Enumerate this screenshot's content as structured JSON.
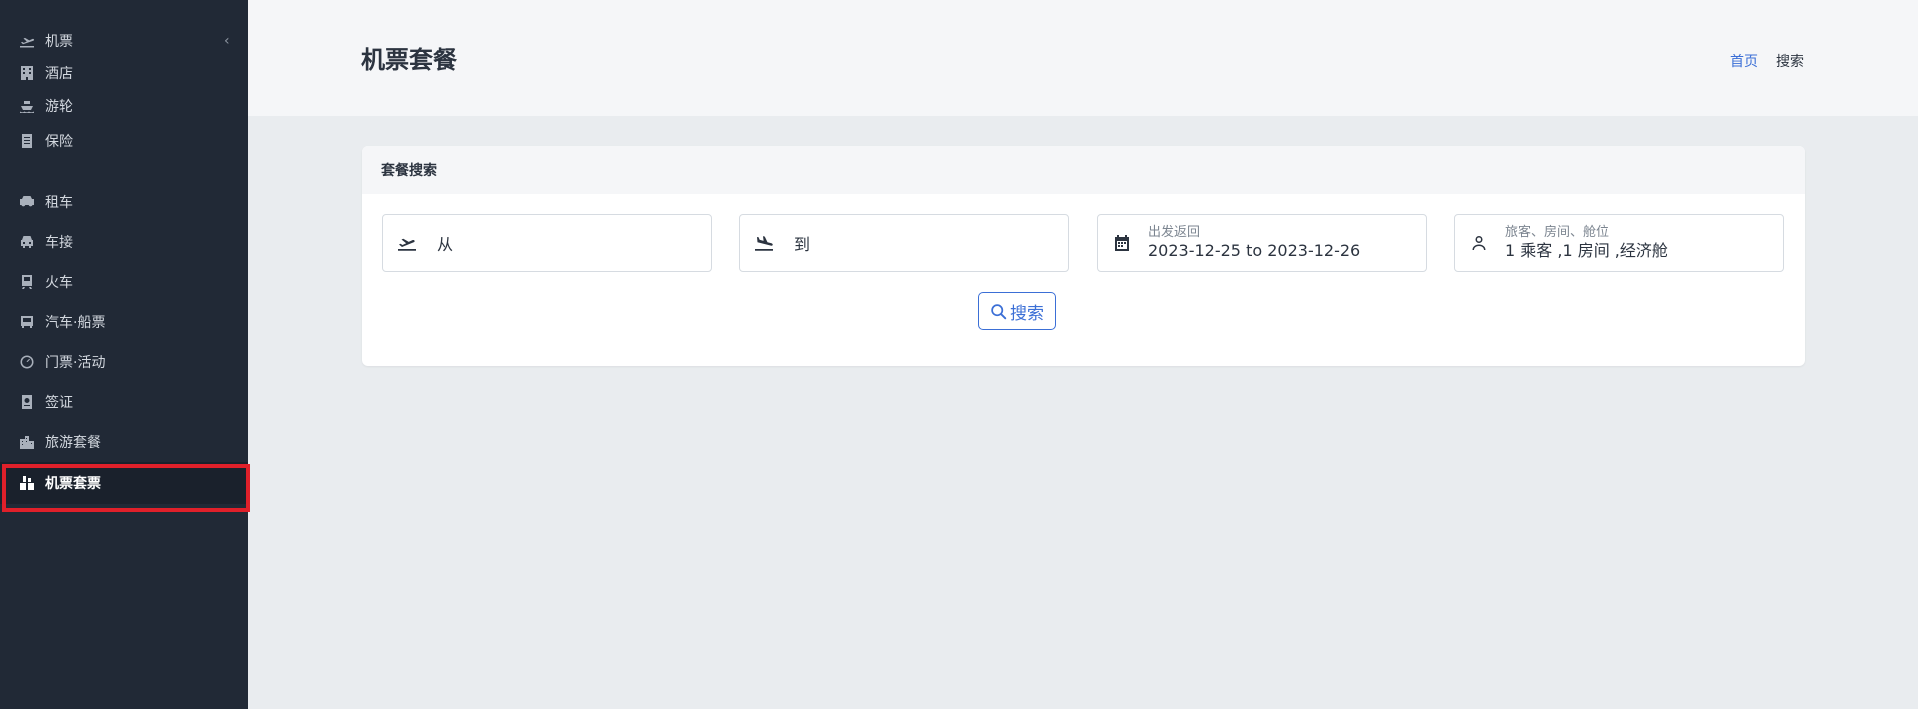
{
  "sidebar": {
    "items": [
      {
        "label": "机票",
        "icon": "plane-takeoff-icon"
      },
      {
        "label": "酒店",
        "icon": "hotel-icon"
      },
      {
        "label": "游轮",
        "icon": "ship-icon"
      },
      {
        "label": "保险",
        "icon": "document-icon"
      },
      {
        "label": "租车",
        "icon": "car-rental-icon"
      },
      {
        "label": "车接",
        "icon": "car-icon"
      },
      {
        "label": "火车",
        "icon": "train-icon"
      },
      {
        "label": "汽车·船票",
        "icon": "bus-icon"
      },
      {
        "label": "门票·活动",
        "icon": "ticket-icon"
      },
      {
        "label": "签证",
        "icon": "passport-icon"
      },
      {
        "label": "旅游套餐",
        "icon": "city-icon"
      },
      {
        "label": "机票套票",
        "icon": "package-icon",
        "active": true
      }
    ],
    "collapse_glyph": "‹"
  },
  "header": {
    "title": "机票套餐",
    "breadcrumb": {
      "home": "首页",
      "current": "搜索"
    }
  },
  "search_card": {
    "title": "套餐搜索",
    "from_placeholder": "从",
    "to_placeholder": "到",
    "dates": {
      "label": "出发返回",
      "value": "2023-12-25 to 2023-12-26"
    },
    "travelers": {
      "label": "旅客、房间、舱位",
      "value": "1 乘客 ,1 房间 ,经济舱"
    },
    "search_label": "搜索"
  },
  "colors": {
    "sidebar_bg": "#212936",
    "accent": "#3b6fd6",
    "highlight": "#e0202a"
  }
}
